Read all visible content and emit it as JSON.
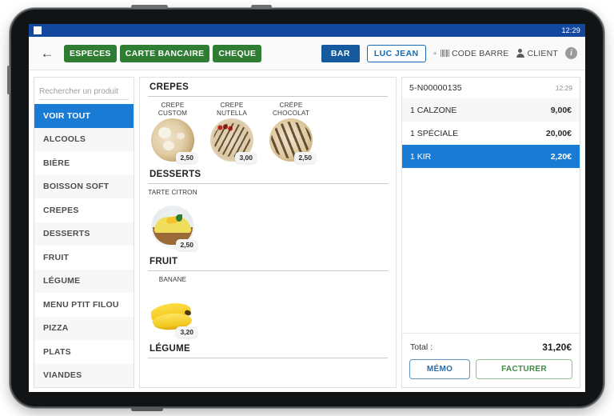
{
  "statusbar": {
    "time": "12:29"
  },
  "toolbar": {
    "back_icon": "arrow-left-icon",
    "payment_buttons": [
      "ESPECES",
      "CARTE BANCAIRE",
      "CHEQUE"
    ],
    "bar_chip": "BAR",
    "user_chip": "LUC JEAN",
    "barcode_label": "CODE BARRE",
    "client_label": "CLIENT",
    "info_icon": "i"
  },
  "sidebar": {
    "search_placeholder": "Rechercher un produit",
    "search_value": "",
    "categories": [
      "VOIR TOUT",
      "ALCOOLS",
      "BIÈRE",
      "BOISSON SOFT",
      "CREPES",
      "DESSERTS",
      "FRUIT",
      "LÉGUME",
      "MENU PTIT FILOU",
      "PIZZA",
      "PLATS",
      "VIANDES"
    ],
    "active_index": 0
  },
  "products": {
    "sections": [
      {
        "title": "CREPES",
        "items": [
          {
            "name": "CREPE CUSTOM",
            "price": "2,50",
            "art": "food-crepe1"
          },
          {
            "name": "CREPE NUTELLA",
            "price": "3,00",
            "art": "food-crepe2"
          },
          {
            "name": "CRÉPE CHOCOLAT",
            "price": "2,50",
            "art": "food-crepe3"
          }
        ]
      },
      {
        "title": "DESSERTS",
        "items": [
          {
            "name": "TARTE CITRON",
            "price": "2,50",
            "art": "food-tarte"
          }
        ]
      },
      {
        "title": "FRUIT",
        "items": [
          {
            "name": "BANANE",
            "price": "3,20",
            "art": "food-banana"
          }
        ]
      },
      {
        "title": "LÉGUME",
        "items": []
      }
    ]
  },
  "ticket": {
    "number": "5-N00000135",
    "time": "12:29",
    "lines": [
      {
        "qty": "1",
        "label": "CALZONE",
        "text": "1 CALZONE",
        "amount": "9,00€"
      },
      {
        "qty": "1",
        "label": "SPÉCIALE",
        "text": "1 SPÉCIALE",
        "amount": "20,00€"
      },
      {
        "qty": "1",
        "label": "KIR",
        "text": "1 KIR",
        "amount": "2,20€"
      }
    ],
    "selected_index": 2,
    "total_label": "Total :",
    "total_amount": "31,20€",
    "memo_button": "MÉMO",
    "invoice_button": "FACTURER"
  },
  "colors": {
    "status_blue": "#14489e",
    "accent_blue": "#1a7bd4",
    "green": "#2e7d32",
    "chip_blue": "#155a9e"
  }
}
